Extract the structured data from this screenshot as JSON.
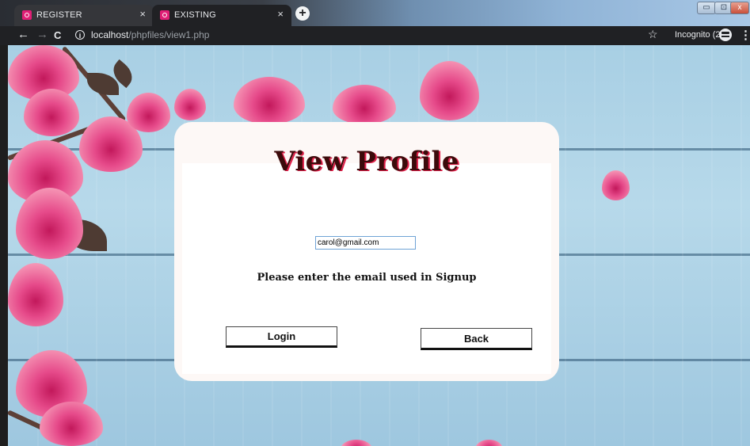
{
  "browser": {
    "tabs": [
      {
        "label": "REGISTER",
        "close": "×"
      },
      {
        "label": "EXISTING",
        "close": "×"
      }
    ],
    "new_tab": "+",
    "nav": {
      "back": "←",
      "forward": "→",
      "reload": "C"
    },
    "address": {
      "host": "localhost",
      "path": "/phpfiles/view1.php"
    },
    "bookmark": "☆",
    "incognito_label": "Incognito (2)",
    "menu": "⋮",
    "window_controls": {
      "minimize": "▭",
      "maximize": "⊡",
      "close": "x"
    }
  },
  "page": {
    "title": "View Profile",
    "email_value": "carol@gmail.com",
    "hint": "Please enter the email used in Signup",
    "login_label": "Login",
    "back_label": "Back"
  },
  "colors": {
    "title_text": "#3b0b0b",
    "title_shadow": "#e0204a",
    "card_bg": "#fdf8f6",
    "wood_blue": "#a8cfe4",
    "blossom_pink": "#e64a8a"
  }
}
